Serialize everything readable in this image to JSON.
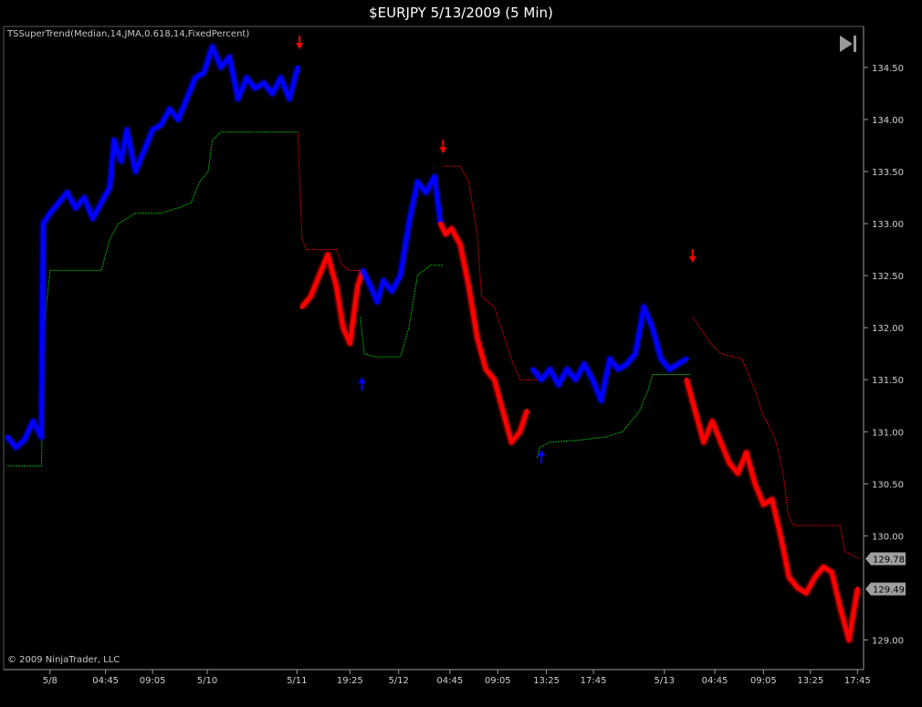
{
  "window": {
    "title": "$EURJPY  5/13/2009 (5 Min)"
  },
  "indicator_label": "TSSuperTrend(Median,14,JMA,0.618,14,FixedPercent)",
  "copyright": "© 2009 NinjaTrader, LLC",
  "icons": {
    "play_end": "skip-to-end-icon"
  },
  "colors": {
    "background": "#000000",
    "up_candle": "#0000ff",
    "down_candle": "#ff0000",
    "support_line": "#00b000",
    "resistance_line": "#d00000",
    "axis": "#9a9a9a",
    "badge": "#a0a0a0"
  },
  "chart_data": {
    "type": "line",
    "ylim": [
      128.75,
      134.85
    ],
    "xlim": [
      0,
      100
    ],
    "y_ticks": [
      {
        "value": 134.5,
        "label": "134.50"
      },
      {
        "value": 134.0,
        "label": "134.00"
      },
      {
        "value": 133.5,
        "label": "133.50"
      },
      {
        "value": 133.0,
        "label": "133.00"
      },
      {
        "value": 132.5,
        "label": "132.50"
      },
      {
        "value": 132.0,
        "label": "132.00"
      },
      {
        "value": 131.5,
        "label": "131.50"
      },
      {
        "value": 131.0,
        "label": "131.00"
      },
      {
        "value": 130.5,
        "label": "130.50"
      },
      {
        "value": 130.0,
        "label": "130.00"
      },
      {
        "value": 129.0,
        "label": "129.00"
      }
    ],
    "x_ticks": [
      {
        "x": 5,
        "label": "5/8"
      },
      {
        "x": 11.5,
        "label": "04:45"
      },
      {
        "x": 17,
        "label": "09:05"
      },
      {
        "x": 23.4,
        "label": "5/10"
      },
      {
        "x": 33.9,
        "label": "5/11"
      },
      {
        "x": 40.1,
        "label": "19:25"
      },
      {
        "x": 45.8,
        "label": "5/12"
      },
      {
        "x": 51.8,
        "label": "04:45"
      },
      {
        "x": 57.4,
        "label": "09:05"
      },
      {
        "x": 63.1,
        "label": "13:25"
      },
      {
        "x": 68.6,
        "label": "17:45"
      },
      {
        "x": 76.9,
        "label": "5/13"
      },
      {
        "x": 82.8,
        "label": "04:45"
      },
      {
        "x": 88.5,
        "label": "09:05"
      },
      {
        "x": 94,
        "label": "13:25"
      },
      {
        "x": 99.5,
        "label": "17:45"
      }
    ],
    "price_badges": [
      {
        "value": 129.78,
        "label": "129.78"
      },
      {
        "value": 129.49,
        "label": "129.49"
      }
    ],
    "series": [
      {
        "kind": "price-up",
        "points": [
          [
            0,
            130.95
          ],
          [
            1,
            130.85
          ],
          [
            2,
            130.92
          ],
          [
            3,
            131.1
          ],
          [
            4,
            130.95
          ],
          [
            4.2,
            133.0
          ],
          [
            5,
            133.1
          ],
          [
            6,
            133.2
          ],
          [
            7,
            133.3
          ],
          [
            8,
            133.15
          ],
          [
            9,
            133.25
          ],
          [
            10,
            133.05
          ],
          [
            11,
            133.2
          ],
          [
            12,
            133.35
          ],
          [
            12.5,
            133.8
          ],
          [
            13.3,
            133.6
          ],
          [
            14,
            133.9
          ],
          [
            15,
            133.5
          ],
          [
            16,
            133.7
          ],
          [
            17,
            133.9
          ],
          [
            18,
            133.95
          ],
          [
            19,
            134.1
          ],
          [
            20,
            134.0
          ],
          [
            21,
            134.2
          ],
          [
            22,
            134.4
          ],
          [
            23,
            134.45
          ],
          [
            24,
            134.7
          ],
          [
            25,
            134.5
          ],
          [
            26,
            134.6
          ],
          [
            27,
            134.2
          ],
          [
            28,
            134.4
          ],
          [
            29,
            134.3
          ],
          [
            30,
            134.35
          ],
          [
            31,
            134.25
          ],
          [
            32,
            134.4
          ],
          [
            33,
            134.2
          ],
          [
            34,
            134.5
          ]
        ]
      },
      {
        "kind": "price-down",
        "points": [
          [
            34.5,
            132.2
          ],
          [
            35.5,
            132.3
          ],
          [
            36.5,
            132.5
          ],
          [
            37.5,
            132.7
          ],
          [
            38.5,
            132.4
          ],
          [
            39.3,
            132.0
          ],
          [
            40.1,
            131.85
          ],
          [
            41,
            132.4
          ],
          [
            41.6,
            132.55
          ]
        ]
      },
      {
        "kind": "price-up",
        "points": [
          [
            41.6,
            132.55
          ],
          [
            42.5,
            132.4
          ],
          [
            43.3,
            132.25
          ],
          [
            44,
            132.45
          ],
          [
            45,
            132.35
          ],
          [
            46,
            132.5
          ],
          [
            47,
            133.0
          ],
          [
            48,
            133.4
          ],
          [
            49,
            133.3
          ],
          [
            50,
            133.45
          ],
          [
            50.7,
            133.0
          ]
        ]
      },
      {
        "kind": "price-down",
        "points": [
          [
            50.7,
            133.0
          ],
          [
            51.3,
            132.9
          ],
          [
            52,
            132.95
          ],
          [
            53,
            132.8
          ],
          [
            54,
            132.4
          ],
          [
            55,
            131.9
          ],
          [
            56,
            131.6
          ],
          [
            57,
            131.5
          ],
          [
            58,
            131.2
          ],
          [
            59,
            130.9
          ],
          [
            60,
            131.0
          ],
          [
            60.8,
            131.2
          ]
        ]
      },
      {
        "kind": "price-up",
        "points": [
          [
            61.5,
            131.6
          ],
          [
            62.5,
            131.5
          ],
          [
            63.5,
            131.6
          ],
          [
            64.5,
            131.45
          ],
          [
            65.5,
            131.6
          ],
          [
            66.5,
            131.5
          ],
          [
            67.5,
            131.65
          ],
          [
            68.5,
            131.5
          ],
          [
            69.5,
            131.3
          ],
          [
            70.5,
            131.7
          ],
          [
            71.5,
            131.6
          ],
          [
            72.5,
            131.65
          ],
          [
            73.5,
            131.75
          ],
          [
            74.5,
            132.2
          ],
          [
            75.5,
            132.0
          ],
          [
            76.5,
            131.7
          ],
          [
            77.5,
            131.6
          ],
          [
            79.5,
            131.7
          ]
        ]
      },
      {
        "kind": "price-down",
        "points": [
          [
            79.5,
            131.5
          ],
          [
            80.5,
            131.2
          ],
          [
            81.5,
            130.9
          ],
          [
            82.5,
            131.1
          ],
          [
            83.5,
            130.9
          ],
          [
            84.5,
            130.7
          ],
          [
            85.5,
            130.6
          ],
          [
            86.5,
            130.8
          ],
          [
            87.5,
            130.5
          ],
          [
            88.5,
            130.3
          ],
          [
            89.5,
            130.35
          ],
          [
            90.5,
            130.0
          ],
          [
            91.5,
            129.6
          ],
          [
            92.5,
            129.5
          ],
          [
            93.5,
            129.45
          ],
          [
            94.5,
            129.6
          ],
          [
            95.5,
            129.7
          ],
          [
            96.5,
            129.65
          ],
          [
            97.5,
            129.3
          ],
          [
            98.5,
            129.0
          ],
          [
            99.5,
            129.49
          ]
        ]
      },
      {
        "kind": "support",
        "points": [
          [
            0,
            130.67
          ],
          [
            4,
            130.67
          ],
          [
            4.3,
            132.0
          ],
          [
            5,
            132.55
          ],
          [
            11,
            132.55
          ],
          [
            12,
            132.85
          ],
          [
            13,
            133.0
          ],
          [
            15,
            133.1
          ],
          [
            18,
            133.1
          ],
          [
            20,
            133.15
          ],
          [
            21.5,
            133.2
          ],
          [
            22.5,
            133.4
          ],
          [
            23.5,
            133.5
          ],
          [
            24,
            133.8
          ],
          [
            25,
            133.88
          ],
          [
            34,
            133.88
          ]
        ]
      },
      {
        "kind": "resistance",
        "points": [
          [
            34,
            133.88
          ],
          [
            34.5,
            132.85
          ],
          [
            35,
            132.75
          ],
          [
            38.5,
            132.75
          ],
          [
            39.2,
            132.6
          ],
          [
            40,
            132.55
          ],
          [
            41.3,
            132.55
          ]
        ]
      },
      {
        "kind": "support",
        "points": [
          [
            41.3,
            132.1
          ],
          [
            41.8,
            131.75
          ],
          [
            43,
            131.72
          ],
          [
            46,
            131.72
          ],
          [
            47,
            132.0
          ],
          [
            48,
            132.5
          ],
          [
            49.5,
            132.6
          ],
          [
            51,
            132.6
          ]
        ]
      },
      {
        "kind": "resistance",
        "points": [
          [
            51,
            133.55
          ],
          [
            53,
            133.55
          ],
          [
            54,
            133.4
          ],
          [
            55,
            132.9
          ],
          [
            55.5,
            132.3
          ],
          [
            57,
            132.2
          ],
          [
            58,
            131.95
          ],
          [
            59,
            131.7
          ],
          [
            60,
            131.5
          ],
          [
            62,
            131.5
          ]
        ]
      },
      {
        "kind": "support",
        "points": [
          [
            62,
            130.75
          ],
          [
            62.3,
            130.85
          ],
          [
            63.5,
            130.9
          ],
          [
            67,
            130.92
          ],
          [
            70,
            130.95
          ],
          [
            72,
            131.0
          ],
          [
            73,
            131.1
          ],
          [
            74,
            131.2
          ],
          [
            75,
            131.4
          ],
          [
            75.5,
            131.55
          ],
          [
            80,
            131.55
          ]
        ]
      },
      {
        "kind": "resistance",
        "points": [
          [
            80.2,
            132.1
          ],
          [
            81.5,
            131.95
          ],
          [
            82.3,
            131.85
          ],
          [
            83.5,
            131.75
          ],
          [
            86,
            131.7
          ],
          [
            86.5,
            131.6
          ],
          [
            87.5,
            131.4
          ],
          [
            88.5,
            131.15
          ],
          [
            89.5,
            131.0
          ],
          [
            90,
            130.9
          ],
          [
            90.8,
            130.6
          ],
          [
            91.4,
            130.2
          ],
          [
            92,
            130.1
          ],
          [
            97.5,
            130.1
          ],
          [
            98,
            129.85
          ],
          [
            99.8,
            129.78
          ]
        ]
      }
    ],
    "signals": [
      {
        "x": 34.2,
        "value": 134.7,
        "direction": "down"
      },
      {
        "x": 41.5,
        "value": 131.5,
        "direction": "up"
      },
      {
        "x": 51.0,
        "value": 133.7,
        "direction": "down"
      },
      {
        "x": 62.5,
        "value": 130.8,
        "direction": "up"
      },
      {
        "x": 80.2,
        "value": 132.65,
        "direction": "down"
      }
    ]
  }
}
